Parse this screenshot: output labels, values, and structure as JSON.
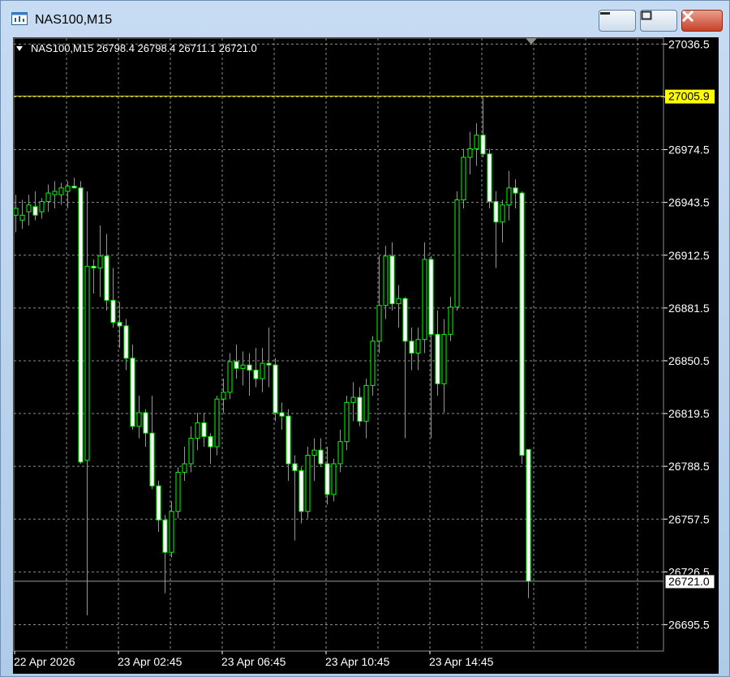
{
  "window": {
    "title": "NAS100,M15"
  },
  "info_line": "NAS100,M15  26798.4 26798.4 26711.1 26721.0",
  "price_labels": {
    "ask_line": "27005.9",
    "bid_line": "26721.0"
  },
  "colors": {
    "background": "#000000",
    "grid": "#8c8c8c",
    "candle": "#00ff00",
    "ask_line": "#e6e600",
    "ask_label_bg": "#ffff00",
    "bid_line": "#9a9a9a"
  },
  "chart_data": {
    "type": "candlestick",
    "y_range": [
      26680.0,
      27040.0
    ],
    "y_ticks": [
      27036.5,
      26974.5,
      26943.5,
      26912.5,
      26881.5,
      26850.5,
      26819.5,
      26788.5,
      26757.5,
      26726.5,
      26695.5
    ],
    "x_tick_labels": [
      "22 Apr 2026",
      "23 Apr 02:45",
      "23 Apr 06:45",
      "23 Apr 10:45",
      "23 Apr 14:45"
    ],
    "ask_price": 27005.9,
    "bid_price": 26721.0,
    "candles": [
      [
        26936.0,
        26948.0,
        26926.0,
        26940.0
      ],
      [
        26933.0,
        26945.0,
        26928.0,
        26936.0
      ],
      [
        26938.0,
        26948.0,
        26930.0,
        26942.0
      ],
      [
        26941.0,
        26950.0,
        26933.0,
        26936.0
      ],
      [
        26938.0,
        26946.0,
        26934.0,
        26944.0
      ],
      [
        26944.0,
        26954.0,
        26938.0,
        26949.0
      ],
      [
        26948.0,
        26956.0,
        26940.0,
        26950.0
      ],
      [
        26948.0,
        26955.0,
        26942.0,
        26952.0
      ],
      [
        26950.0,
        26956.0,
        26940.0,
        26953.0
      ],
      [
        26953.0,
        26958.0,
        26952.0,
        26952.0
      ],
      [
        26952.0,
        26956.0,
        26790.0,
        26791.0
      ],
      [
        26792.0,
        26950.0,
        26701.0,
        26906.0
      ],
      [
        26906.0,
        26910.0,
        26890.0,
        26905.0
      ],
      [
        26905.0,
        26930.0,
        26888.0,
        26912.0
      ],
      [
        26912.0,
        26925.0,
        26880.0,
        26886.0
      ],
      [
        26886.0,
        26905.0,
        26870.0,
        26873.0
      ],
      [
        26873.0,
        26885.0,
        26858.0,
        26871.0
      ],
      [
        26871.0,
        26875.0,
        26845.0,
        26852.0
      ],
      [
        26852.0,
        26860.0,
        26810.0,
        26812.0
      ],
      [
        26812.0,
        26830.0,
        26805.0,
        26820.0
      ],
      [
        26820.0,
        26822.0,
        26800.0,
        26808.0
      ],
      [
        26808.0,
        26830.0,
        26775.0,
        26777.0
      ],
      [
        26777.0,
        26780.0,
        26750.0,
        26757.0
      ],
      [
        26757.0,
        26760.0,
        26714.0,
        26738.0
      ],
      [
        26738.0,
        26768.0,
        26735.0,
        26762.0
      ],
      [
        26762.0,
        26788.0,
        26758.0,
        26785.0
      ],
      [
        26785.0,
        26800.0,
        26780.0,
        26790.0
      ],
      [
        26790.0,
        26812.0,
        26785.0,
        26805.0
      ],
      [
        26805.0,
        26820.0,
        26798.0,
        26814.0
      ],
      [
        26814.0,
        26820.0,
        26800.0,
        26806.0
      ],
      [
        26806.0,
        26808.0,
        26790.0,
        26800.0
      ],
      [
        26800.0,
        26830.0,
        26795.0,
        26828.0
      ],
      [
        26828.0,
        26840.0,
        26820.0,
        26832.0
      ],
      [
        26832.0,
        26855.0,
        26828.0,
        26850.0
      ],
      [
        26850.0,
        26860.0,
        26840.0,
        26846.0
      ],
      [
        26846.0,
        26856.0,
        26836.0,
        26848.0
      ],
      [
        26848.0,
        26855.0,
        26830.0,
        26845.0
      ],
      [
        26845.0,
        26858.0,
        26835.0,
        26840.0
      ],
      [
        26840.0,
        26858.0,
        26832.0,
        26849.0
      ],
      [
        26849.0,
        26870.0,
        26835.0,
        26848.0
      ],
      [
        26848.0,
        26852.0,
        26815.0,
        26820.0
      ],
      [
        26820.0,
        26826.0,
        26810.0,
        26818.0
      ],
      [
        26818.0,
        26822.0,
        26780.0,
        26790.0
      ],
      [
        26790.0,
        26795.0,
        26745.0,
        26786.0
      ],
      [
        26786.0,
        26788.0,
        26755.0,
        26762.0
      ],
      [
        26762.0,
        26800.0,
        26758.0,
        26795.0
      ],
      [
        26795.0,
        26805.0,
        26780.0,
        26798.0
      ],
      [
        26798.0,
        26805.0,
        26788.0,
        26790.0
      ],
      [
        26790.0,
        26800.0,
        26766.0,
        26772.0
      ],
      [
        26772.0,
        26793.0,
        26768.0,
        26790.0
      ],
      [
        26790.0,
        26810.0,
        26785.0,
        26803.0
      ],
      [
        26803.0,
        26830.0,
        26798.0,
        26826.0
      ],
      [
        26826.0,
        26838.0,
        26815.0,
        26829.0
      ],
      [
        26829.0,
        26835.0,
        26812.0,
        26815.0
      ],
      [
        26815.0,
        26840.0,
        26805.0,
        26836.0
      ],
      [
        26836.0,
        26865.0,
        26830.0,
        26862.0
      ],
      [
        26862.0,
        26912.0,
        26855.0,
        26883.0
      ],
      [
        26883.0,
        26918.0,
        26875.0,
        26912.0
      ],
      [
        26912.0,
        26920.0,
        26880.0,
        26884.0
      ],
      [
        26884.0,
        26895.0,
        26870.0,
        26887.0
      ],
      [
        26887.0,
        26888.0,
        26805.0,
        26862.0
      ],
      [
        26862.0,
        26870.0,
        26845.0,
        26855.0
      ],
      [
        26855.0,
        26870.0,
        26845.0,
        26863.0
      ],
      [
        26863.0,
        26920.0,
        26855.0,
        26910.0
      ],
      [
        26910.0,
        26912.0,
        26805.0,
        26866.0
      ],
      [
        26866.0,
        26880.0,
        26830.0,
        26837.0
      ],
      [
        26837.0,
        26875.0,
        26820.0,
        26866.0
      ],
      [
        26866.0,
        26888.0,
        26862.0,
        26882.0
      ],
      [
        26882.0,
        26950.0,
        26880.0,
        26945.0
      ],
      [
        26945.0,
        26975.0,
        26940.0,
        26970.0
      ],
      [
        26970.0,
        26985.0,
        26960.0,
        26975.0
      ],
      [
        26975.0,
        26990.0,
        26965.0,
        26983.0
      ],
      [
        26983.0,
        27005.0,
        26970.0,
        26972.0
      ],
      [
        26972.0,
        26975.0,
        26940.0,
        26944.0
      ],
      [
        26944.0,
        26950.0,
        26905.0,
        26932.0
      ],
      [
        26932.0,
        26945.0,
        26920.0,
        26942.0
      ],
      [
        26942.0,
        26962.0,
        26933.0,
        26952.0
      ],
      [
        26952.0,
        26957.0,
        26940.0,
        26949.0
      ],
      [
        26949.0,
        26950.0,
        26790.0,
        26795.0
      ],
      [
        26798.4,
        26798.4,
        26711.1,
        26721.0
      ]
    ]
  }
}
